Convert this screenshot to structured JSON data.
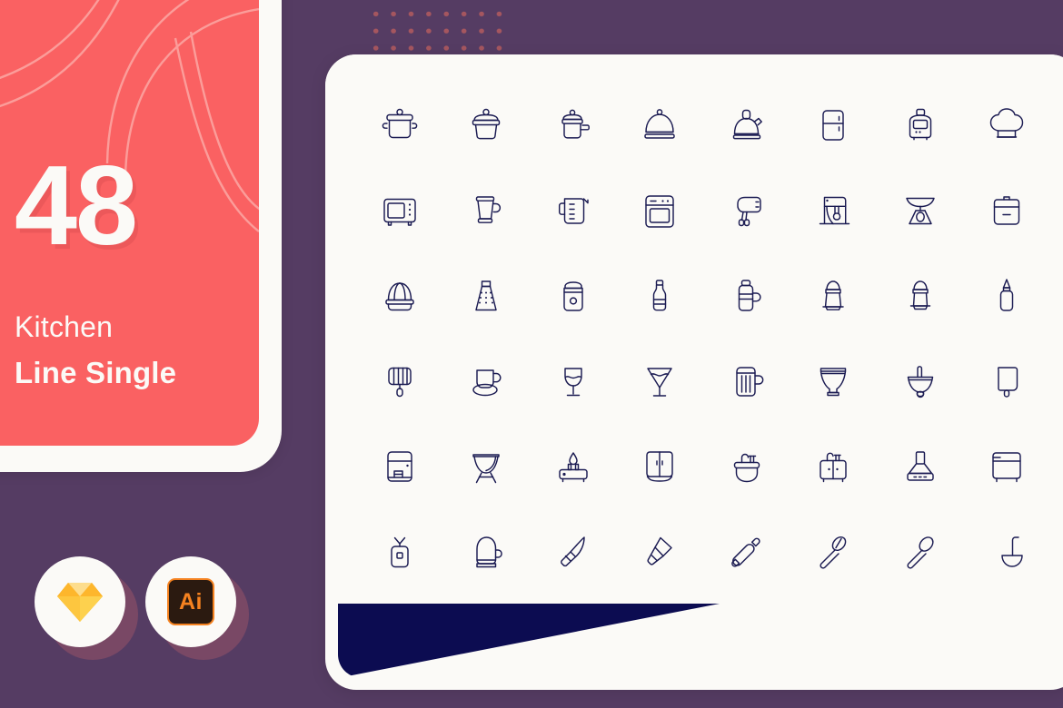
{
  "colors": {
    "background_purple": "#553C63",
    "promo_red": "#FA6162",
    "card_white": "#FBFAF7",
    "icon_navy": "#1B1B52",
    "wedge_navy": "#0C0C51",
    "dot_red": "#B35B5E",
    "ai_orange": "#F58220"
  },
  "promo": {
    "count": "48",
    "title_line1": "Kitchen",
    "title_line2": "Line Single"
  },
  "badges": [
    {
      "name": "sketch-badge",
      "icon": "sketch-diamond-icon",
      "label": ""
    },
    {
      "name": "illustrator-badge",
      "icon": "adobe-illustrator-icon",
      "label": "Ai"
    }
  ],
  "decor": {
    "dot_grid": "dot-grid-pattern",
    "swirls": "curved-line-decoration",
    "wedge": "navy-corner-wedge"
  },
  "icon_grid": {
    "columns": 8,
    "rows": 6,
    "total": 48,
    "icons": [
      "stock-pot-icon",
      "cooking-pot-icon",
      "saucepan-icon",
      "food-cloche-icon",
      "kettle-icon",
      "refrigerator-icon",
      "toaster-icon",
      "chef-hat-icon",
      "microwave-icon",
      "blender-icon",
      "measuring-cup-icon",
      "oven-icon",
      "hand-mixer-icon",
      "stand-mixer-icon",
      "kitchen-scale-icon",
      "trash-bin-icon",
      "citrus-juicer-icon",
      "cheese-grater-icon",
      "storage-jar-icon",
      "bottle-icon",
      "thermos-flask-icon",
      "salt-shaker-icon",
      "pepper-shaker-icon",
      "sauce-bottle-icon",
      "whisk-icon",
      "teacup-saucer-icon",
      "wine-glass-icon",
      "cocktail-glass-icon",
      "beer-mug-icon",
      "goblet-icon",
      "mortar-pestle-icon",
      "cutting-board-icon",
      "coffee-machine-icon",
      "bbq-grill-icon",
      "gas-stove-icon",
      "kitchen-cabinet-icon",
      "kitchen-sink-icon",
      "double-sink-icon",
      "range-hood-icon",
      "dishwasher-icon",
      "apron-icon",
      "oven-mitt-icon",
      "chef-knife-icon",
      "cleaver-icon",
      "rolling-pin-icon",
      "slotted-spatula-icon",
      "spoon-icon",
      "ladle-icon"
    ]
  }
}
